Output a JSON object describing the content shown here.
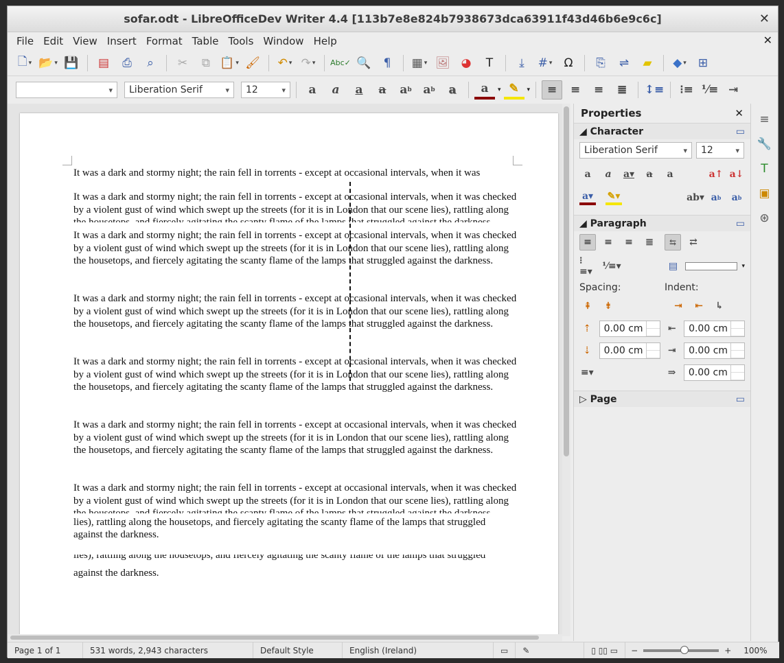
{
  "window": {
    "title": "sofar.odt - LibreOfficeDev Writer 4.4 [113b7e8e824b7938673dca63911f43d46b6e9c6c]"
  },
  "menu": [
    "File",
    "Edit",
    "View",
    "Insert",
    "Format",
    "Table",
    "Tools",
    "Window",
    "Help"
  ],
  "formatting": {
    "paragraph_style": "",
    "font_name": "Liberation Serif",
    "font_size": "12"
  },
  "document": {
    "header_line": "It was a dark and stormy night; the rain fell in torrents - except at occasional intervals, when it was",
    "paragraph": "It was a dark and stormy night; the rain fell in torrents - except at occasional intervals, when it was checked by a violent gust of wind which swept up the streets (for it is in London that our scene lies), rattling along the housetops, and fiercely agitating the scanty flame of the lamps that struggled against the darkness.",
    "tail_line1": "lies), rattling along the housetops, and fiercely agitating the scanty flame of the lamps that struggled",
    "tail_line2": "against the darkness."
  },
  "sidebar": {
    "title": "Properties",
    "character_label": "Character",
    "font_name": "Liberation Serif",
    "font_size": "12",
    "paragraph_label": "Paragraph",
    "spacing_label": "Spacing:",
    "indent_label": "Indent:",
    "above_spacing": "0.00 cm",
    "below_spacing": "0.00 cm",
    "before_indent": "0.00 cm",
    "after_indent": "0.00 cm",
    "first_line_indent": "0.00 cm",
    "page_label": "Page"
  },
  "status": {
    "page": "Page 1 of 1",
    "words": "531 words, 2,943 characters",
    "page_style": "Default Style",
    "language": "English (Ireland)",
    "zoom": "100%"
  },
  "colors": {
    "accent": "#3b5ea8",
    "font_color": "#8b0000",
    "highlight": "#f5e600"
  }
}
